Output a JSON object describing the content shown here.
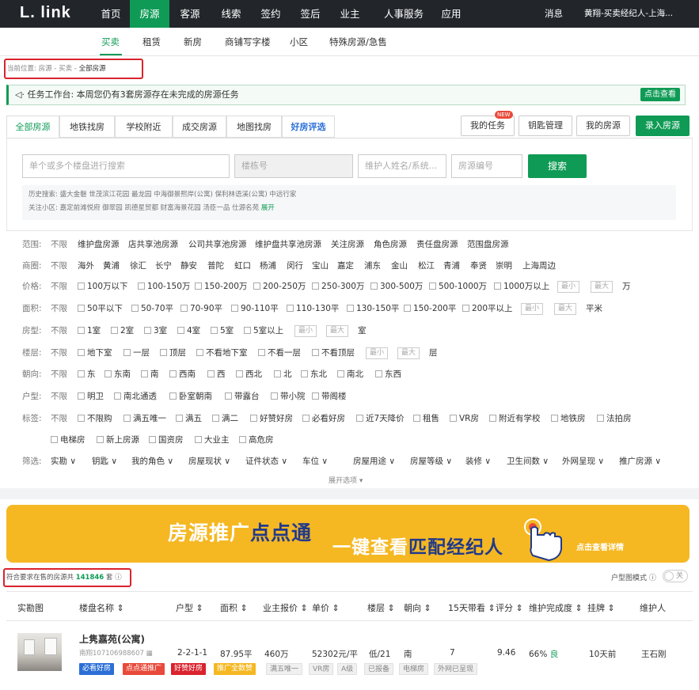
{
  "brand": {
    "logo": "L. link"
  },
  "topnav": {
    "items": [
      "首页",
      "房源",
      "客源",
      "线索",
      "签约",
      "签后",
      "业主",
      "人事服务",
      "应用"
    ],
    "active": "房源",
    "messages": "消息",
    "user": "黄翔-买卖经纪人-上海..."
  },
  "subnav": {
    "items": [
      "买卖",
      "租赁",
      "新房",
      "商铺写字楼",
      "小区",
      "特殊房源/急售"
    ],
    "active": "买卖"
  },
  "breadcrumb": {
    "label": "当前位置:",
    "path1": "房源",
    "sep": "-",
    "path2": "买卖",
    "path3": "全部房源"
  },
  "notice": {
    "text": "任务工作台: 本周您仍有3套房源存在未完成的房源任务",
    "button": "点击查看"
  },
  "tabs": [
    "全部房源",
    "地铁找房",
    "学校附近",
    "成交房源",
    "地图找房",
    "好房评选"
  ],
  "right_buttons": {
    "tasks": "我的任务",
    "new_badge": "NEW",
    "keys": "钥匙管理",
    "my_listings": "我的房源",
    "add": "录入房源"
  },
  "search": {
    "ph_community": "单个或多个楼盘进行搜索",
    "ph_building": "楼栋号",
    "ph_owner": "维护人姓名/系统...",
    "ph_id": "房源编号",
    "button": "搜索"
  },
  "history": {
    "label": "历史搜索:",
    "items": "盛大金磐  世茂滨江花园  最龙园  中海御景熙岸(公寓)  保利林语溪(公寓)  中远行家",
    "follow_label": "关注小区:",
    "follow_items": "嘉定前滩悦府  御翠园  凯德星贸都  财富海景花园  汤臣一品  仕源名苑",
    "more": "展开"
  },
  "filters": {
    "range": {
      "label": "范围:",
      "opts": [
        "不限",
        "维护盘房源",
        "店共享池房源",
        "公司共享池房源",
        "维护盘共享池房源",
        "关注房源",
        "角色房源",
        "责任盘房源",
        "范围盘房源"
      ]
    },
    "district": {
      "label": "商圈:",
      "opts": [
        "不限",
        "海外",
        "黄浦",
        "徐汇",
        "长宁",
        "静安",
        "普陀",
        "虹口",
        "杨浦",
        "闵行",
        "宝山",
        "嘉定",
        "浦东",
        "金山",
        "松江",
        "青浦",
        "奉贤",
        "崇明",
        "上海周边"
      ]
    },
    "price": {
      "label": "价格:",
      "opts": [
        "不限",
        "100万以下",
        "100-150万",
        "150-200万",
        "200-250万",
        "250-300万",
        "300-500万",
        "500-1000万",
        "1000万以上"
      ],
      "min": "最小",
      "max": "最大",
      "unit": "万"
    },
    "area": {
      "label": "面积:",
      "opts": [
        "不限",
        "50平以下",
        "50-70平",
        "70-90平",
        "90-110平",
        "110-130平",
        "130-150平",
        "150-200平",
        "200平以上"
      ],
      "min": "最小",
      "max": "最大",
      "unit": "平米"
    },
    "rooms": {
      "label": "房型:",
      "opts": [
        "不限",
        "1室",
        "2室",
        "3室",
        "4室",
        "5室",
        "5室以上"
      ],
      "min": "最小",
      "max": "最大",
      "unit": "室"
    },
    "floor": {
      "label": "楼层:",
      "opts": [
        "不限",
        "地下室",
        "一层",
        "顶层",
        "不看地下室",
        "不看一层",
        "不看顶层"
      ],
      "min": "最小",
      "max": "最大",
      "unit": "层"
    },
    "facing": {
      "label": "朝向:",
      "opts": [
        "不限",
        "东",
        "东南",
        "南",
        "西南",
        "西",
        "西北",
        "北",
        "东北",
        "南北",
        "东西"
      ]
    },
    "layout": {
      "label": "户型:",
      "opts": [
        "不限",
        "明卫",
        "南北通透",
        "卧室朝南",
        "带露台",
        "带小院",
        "带阁楼"
      ]
    },
    "tags": {
      "label": "标签:",
      "opts": [
        "不限",
        "不限购",
        "满五唯一",
        "满五",
        "满二",
        "好赞好房",
        "必看好房",
        "近7天降价",
        "租售",
        "VR房",
        "附近有学校",
        "地铁房",
        "法拍房"
      ],
      "opts2": [
        "电梯房",
        "新上房源",
        "国资房",
        "大业主",
        "高危房"
      ]
    },
    "more": {
      "label": "筛选:",
      "opts": [
        "实勘",
        "钥匙",
        "我的角色",
        "房屋现状",
        "证件状态",
        "车位",
        "房屋用途",
        "房屋等级",
        "装修",
        "卫生间数",
        "外网呈现",
        "推广房源"
      ]
    },
    "expand": "展开选项"
  },
  "banner": {
    "part1": "房源推广",
    "part2": "点点通",
    "part3": "一键查看",
    "part4": "匹配经纪人",
    "cta": "点击查看详情"
  },
  "results": {
    "prefix": "符合要求在售的房源共",
    "count": "141846",
    "suffix": "套",
    "view_mode": "户型图模式",
    "toggle": "关"
  },
  "table": {
    "headers": [
      "实勘图",
      "楼盘名称",
      "户型",
      "面积",
      "业主报价",
      "单价",
      "楼层",
      "朝向",
      "15天带看",
      "评分",
      "维护完成度",
      "挂牌",
      "维护人"
    ],
    "rows": [
      {
        "name": "上隽嘉苑(公寓)",
        "code": "南翔107106988607",
        "layout": "2-2-1-1",
        "area": "87.95平",
        "price": "460万",
        "unit_price": "52302元/平",
        "floor": "低/21",
        "facing": "南",
        "views": "7",
        "score": "9.46",
        "completion": "66%",
        "grade": "良",
        "listed": "10天前",
        "agent": "王石刚",
        "tags": [
          {
            "text": "必看好房",
            "color": "#2b6fd6"
          },
          {
            "text": "点点通推广",
            "color": "#e8493a"
          },
          {
            "text": "好赞好房",
            "color": "#d9232d"
          },
          {
            "text": "推广全数赞",
            "color": "#f5b823"
          }
        ],
        "plain_tags": [
          "满五唯一",
          "VR房",
          "A级",
          "已报备",
          "电梯房",
          "外网已呈现"
        ]
      }
    ]
  }
}
